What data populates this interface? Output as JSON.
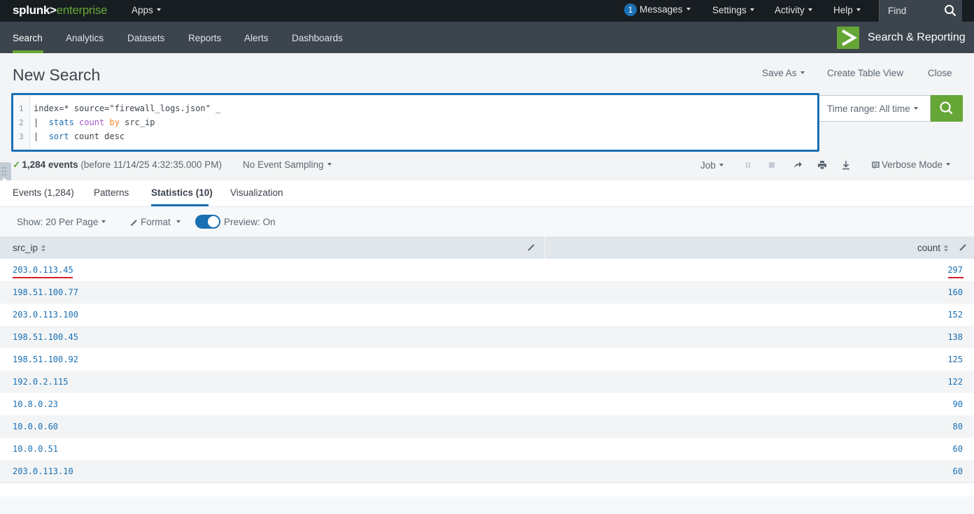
{
  "topbar": {
    "logo_brand": "splunk>",
    "logo_product": "enterprise",
    "apps": "Apps",
    "messages_count": "1",
    "messages": "Messages",
    "settings": "Settings",
    "activity": "Activity",
    "help": "Help",
    "find_placeholder": "Find"
  },
  "appbar": {
    "tabs": [
      "Search",
      "Analytics",
      "Datasets",
      "Reports",
      "Alerts",
      "Dashboards"
    ],
    "active_tab": "Search",
    "app_title": "Search & Reporting"
  },
  "header": {
    "title": "New Search",
    "save_as": "Save As",
    "create_table_view": "Create Table View",
    "close": "Close"
  },
  "search": {
    "line_numbers": [
      "1",
      "2",
      "3"
    ],
    "line1": "index=* source=\"firewall_logs.json\" _",
    "line2_pipe": "|  ",
    "line2_cmd": "stats",
    "line2_fn": "count",
    "line2_by": "by",
    "line2_field": "src_ip",
    "line3_pipe": "|  ",
    "line3_cmd": "sort",
    "line3_rest": " count desc",
    "time_range": "Time range: All time"
  },
  "status": {
    "events_count": "1,284 events",
    "before": "(before 11/14/25 4:32:35.000 PM)",
    "sampling": "No Event Sampling",
    "job": "Job",
    "mode": "Verbose Mode"
  },
  "result_tabs": [
    "Events (1,284)",
    "Patterns",
    "Statistics (10)",
    "Visualization"
  ],
  "active_result_tab": "Statistics (10)",
  "table_options": {
    "show": "Show: 20 Per Page",
    "format": "Format",
    "preview": "Preview: On"
  },
  "table": {
    "columns": [
      "src_ip",
      "count"
    ],
    "rows": [
      {
        "src_ip": "203.0.113.45",
        "count": "297"
      },
      {
        "src_ip": "198.51.100.77",
        "count": "160"
      },
      {
        "src_ip": "203.0.113.100",
        "count": "152"
      },
      {
        "src_ip": "198.51.100.45",
        "count": "138"
      },
      {
        "src_ip": "198.51.100.92",
        "count": "125"
      },
      {
        "src_ip": "192.0.2.115",
        "count": "122"
      },
      {
        "src_ip": "10.8.0.23",
        "count": "90"
      },
      {
        "src_ip": "10.0.0.60",
        "count": "80"
      },
      {
        "src_ip": "10.0.0.51",
        "count": "60"
      },
      {
        "src_ip": "203.0.113.10",
        "count": "60"
      }
    ]
  },
  "colors": {
    "brand_green": "#65a637",
    "link_blue": "#1a6fb3",
    "highlight_red": "#d6202c"
  }
}
